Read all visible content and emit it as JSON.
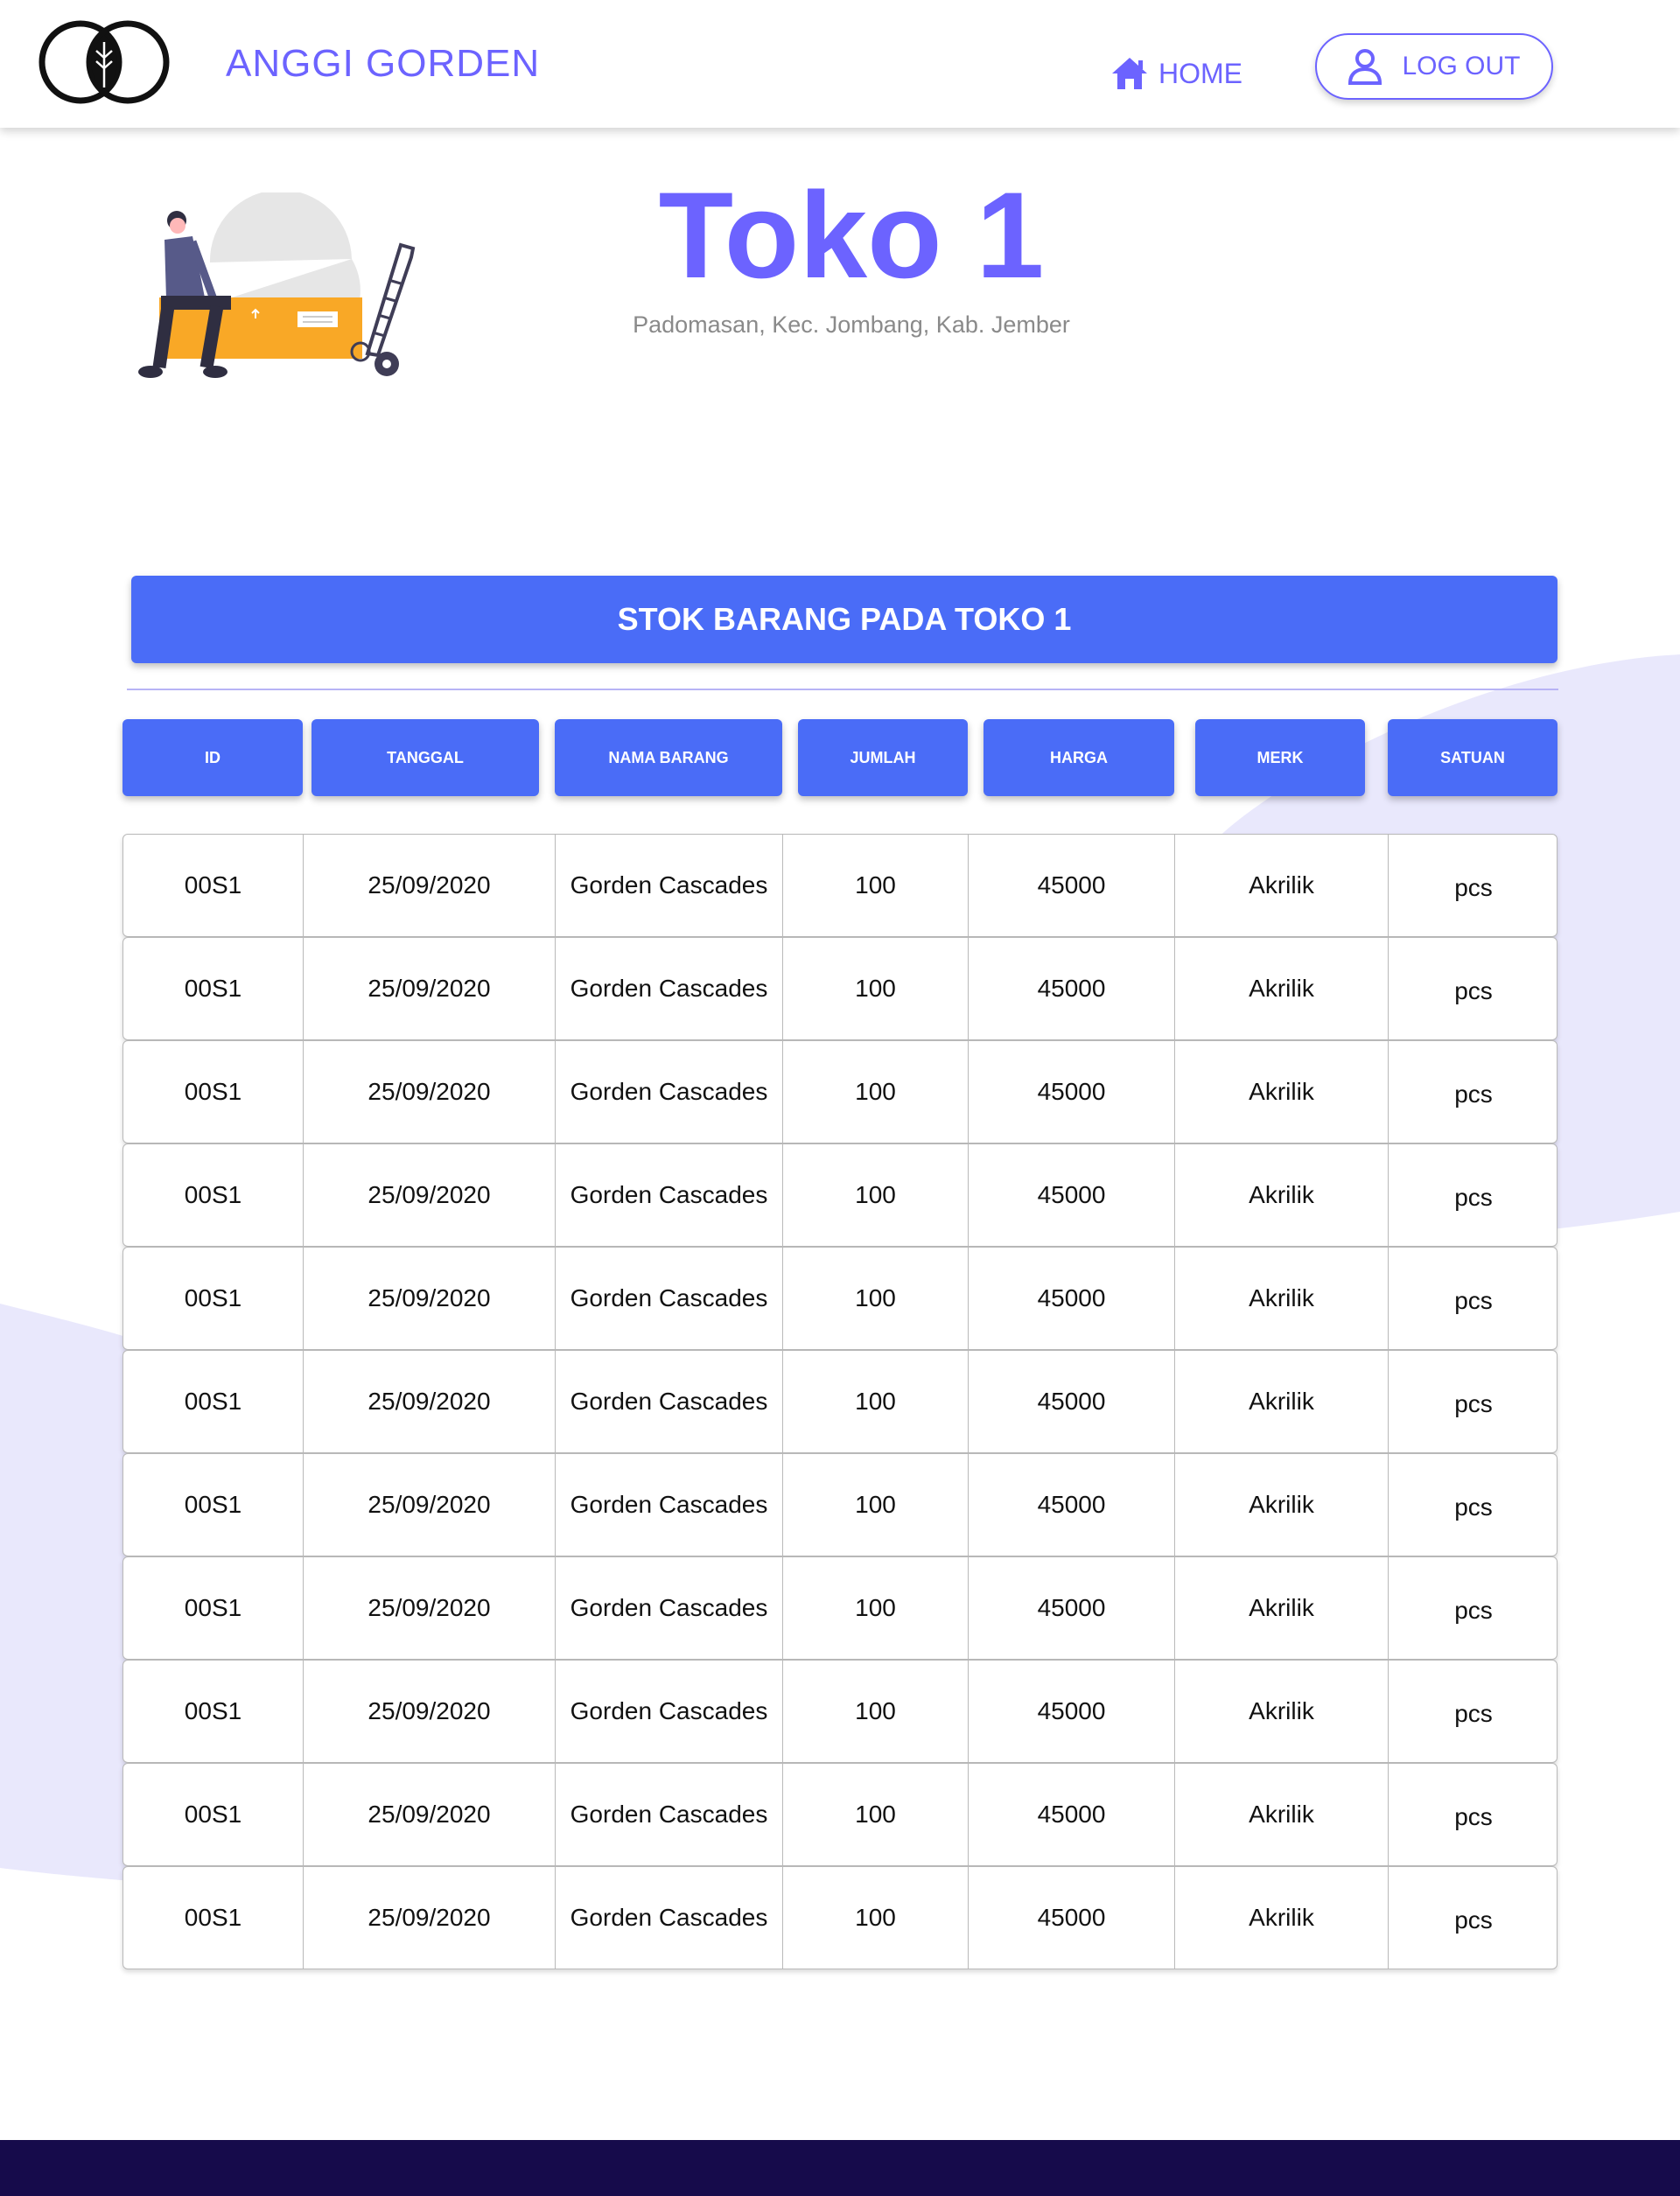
{
  "brand": {
    "name": "ANGGI GORDEN",
    "logo_icon": "leaf-circle-logo-icon"
  },
  "nav": {
    "home_label": "HOME",
    "home_icon": "home-icon",
    "logout_label": "LOG OUT",
    "logout_icon": "user-icon"
  },
  "hero": {
    "title": "Toko 1",
    "subtitle": "Padomasan, Kec. Jombang, Kab. Jember",
    "illustration": "person-sitting-on-box-with-hand-truck"
  },
  "section": {
    "title": "STOK BARANG PADA TOKO 1"
  },
  "table": {
    "columns": [
      "ID",
      "TANGGAL",
      "NAMA BARANG",
      "JUMLAH",
      "HARGA",
      "MERK",
      "SATUAN"
    ],
    "rows": [
      [
        "00S1",
        "25/09/2020",
        "Gorden Cascades",
        "100",
        "45000",
        "Akrilik",
        "pcs"
      ],
      [
        "00S1",
        "25/09/2020",
        "Gorden Cascades",
        "100",
        "45000",
        "Akrilik",
        "pcs"
      ],
      [
        "00S1",
        "25/09/2020",
        "Gorden Cascades",
        "100",
        "45000",
        "Akrilik",
        "pcs"
      ],
      [
        "00S1",
        "25/09/2020",
        "Gorden Cascades",
        "100",
        "45000",
        "Akrilik",
        "pcs"
      ],
      [
        "00S1",
        "25/09/2020",
        "Gorden Cascades",
        "100",
        "45000",
        "Akrilik",
        "pcs"
      ],
      [
        "00S1",
        "25/09/2020",
        "Gorden Cascades",
        "100",
        "45000",
        "Akrilik",
        "pcs"
      ],
      [
        "00S1",
        "25/09/2020",
        "Gorden Cascades",
        "100",
        "45000",
        "Akrilik",
        "pcs"
      ],
      [
        "00S1",
        "25/09/2020",
        "Gorden Cascades",
        "100",
        "45000",
        "Akrilik",
        "pcs"
      ],
      [
        "00S1",
        "25/09/2020",
        "Gorden Cascades",
        "100",
        "45000",
        "Akrilik",
        "pcs"
      ],
      [
        "00S1",
        "25/09/2020",
        "Gorden Cascades",
        "100",
        "45000",
        "Akrilik",
        "pcs"
      ],
      [
        "00S1",
        "25/09/2020",
        "Gorden Cascades",
        "100",
        "45000",
        "Akrilik",
        "pcs"
      ]
    ]
  },
  "colors": {
    "accent": "#6c63ff",
    "button_blue": "#4a6cf7",
    "footer": "#160b4b",
    "blob": "#e9e8fc"
  }
}
